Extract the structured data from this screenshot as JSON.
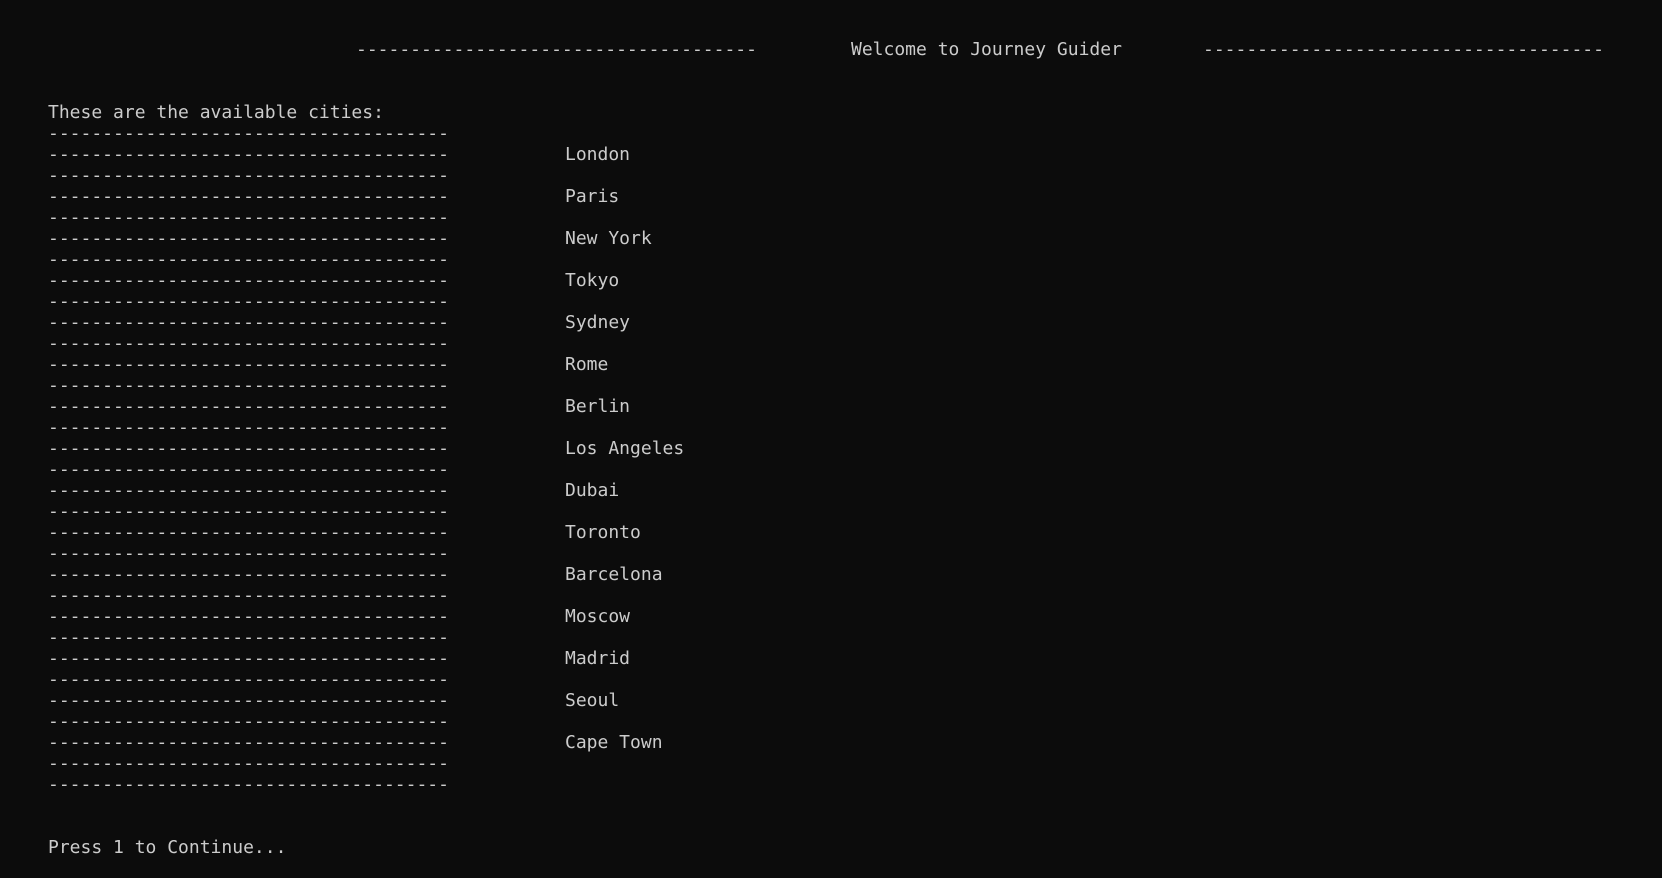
{
  "header": {
    "title": "Welcome to Journey Guider",
    "left_rule": "-------------------------------------",
    "right_rule": "-------------------------------------"
  },
  "intro": "These are the available cities:",
  "rule": "-------------------------------------",
  "cities": [
    "London",
    "Paris",
    "New York",
    "Tokyo",
    "Sydney",
    "Rome",
    "Berlin",
    "Los Angeles",
    "Dubai",
    "Toronto",
    "Barcelona",
    "Moscow",
    "Madrid",
    "Seoul",
    "Cape Town"
  ],
  "prompt": "Press 1 to Continue..."
}
